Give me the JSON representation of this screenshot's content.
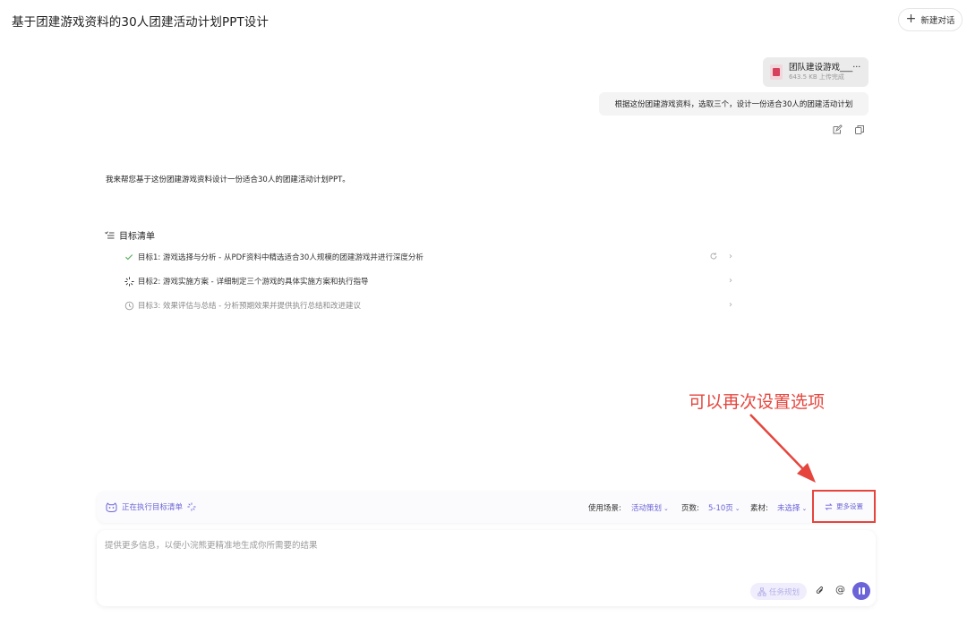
{
  "header": {
    "title": "基于团建游戏资料的30人团建活动计划PPT设计",
    "new_chat_label": "新建对话"
  },
  "conversation": {
    "attachment": {
      "name": "团队建设游戏___···",
      "meta": "643.5 KB 上传完成"
    },
    "user_message": "根据这份团建游戏资料，选取三个，设计一份适合30人的团建活动计划",
    "assistant_message": "我来帮您基于这份团建游戏资料设计一份适合30人的团建活动计划PPT。"
  },
  "goals": {
    "title": "目标清单",
    "items": [
      {
        "label": "目标1: 游戏选择与分析 - 从PDF资料中精选适合30人规模的团建游戏并进行深度分析",
        "status": "done",
        "color": "#4caf50"
      },
      {
        "label": "目标2: 游戏实施方案 - 详细制定三个游戏的具体实施方案和执行指导",
        "status": "running",
        "color": "#333333"
      },
      {
        "label": "目标3: 效果评估与总结 - 分析预期效果并提供执行总结和改进建议",
        "status": "pending",
        "color": "#888888"
      }
    ]
  },
  "annotation": {
    "text": "可以再次设置选项",
    "color": "#e5453d"
  },
  "options": {
    "exec_status": "正在执行目标清单",
    "scene_label": "使用场景:",
    "scene_value": "活动策划",
    "pages_label": "页数:",
    "pages_value": "5-10页",
    "material_label": "素材:",
    "material_value": "未选择",
    "more_settings": "更多设置",
    "accent": "#6b63d8"
  },
  "input": {
    "placeholder": "提供更多信息，以便小浣熊更精准地生成你所需要的结果",
    "task_plan_label": "任务规划"
  }
}
